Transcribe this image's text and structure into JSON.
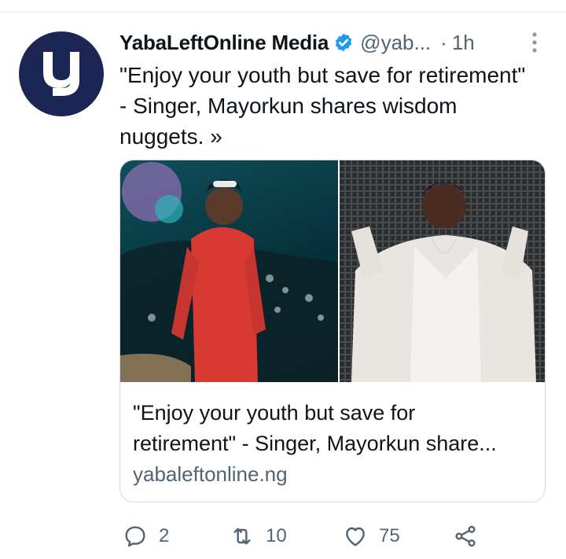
{
  "author": {
    "name": "YabaLeftOnline Media",
    "handle": "@yab...",
    "separator": "·",
    "time": "1h",
    "avatar_letter": "y"
  },
  "tweet": {
    "text": "\"Enjoy your youth but save for retirement\" - Singer, Mayorkun shares wisdom nuggets. »"
  },
  "card": {
    "title_line1": "\"Enjoy your youth but save for",
    "title_line2": "retirement\" - Singer, Mayorkun share...",
    "domain": "yabaleftonline.ng"
  },
  "actions": {
    "replies": "2",
    "retweets": "10",
    "likes": "75"
  },
  "icons": {
    "verified": "verified-badge-icon",
    "more": "more-vertical-icon",
    "reply": "reply-icon",
    "retweet": "retweet-icon",
    "like": "heart-icon",
    "share": "share-icon"
  },
  "colors": {
    "avatar_bg": "#1c2654",
    "verified": "#1d9bf0",
    "secondary_text": "#536471",
    "border": "#cfd9de"
  }
}
